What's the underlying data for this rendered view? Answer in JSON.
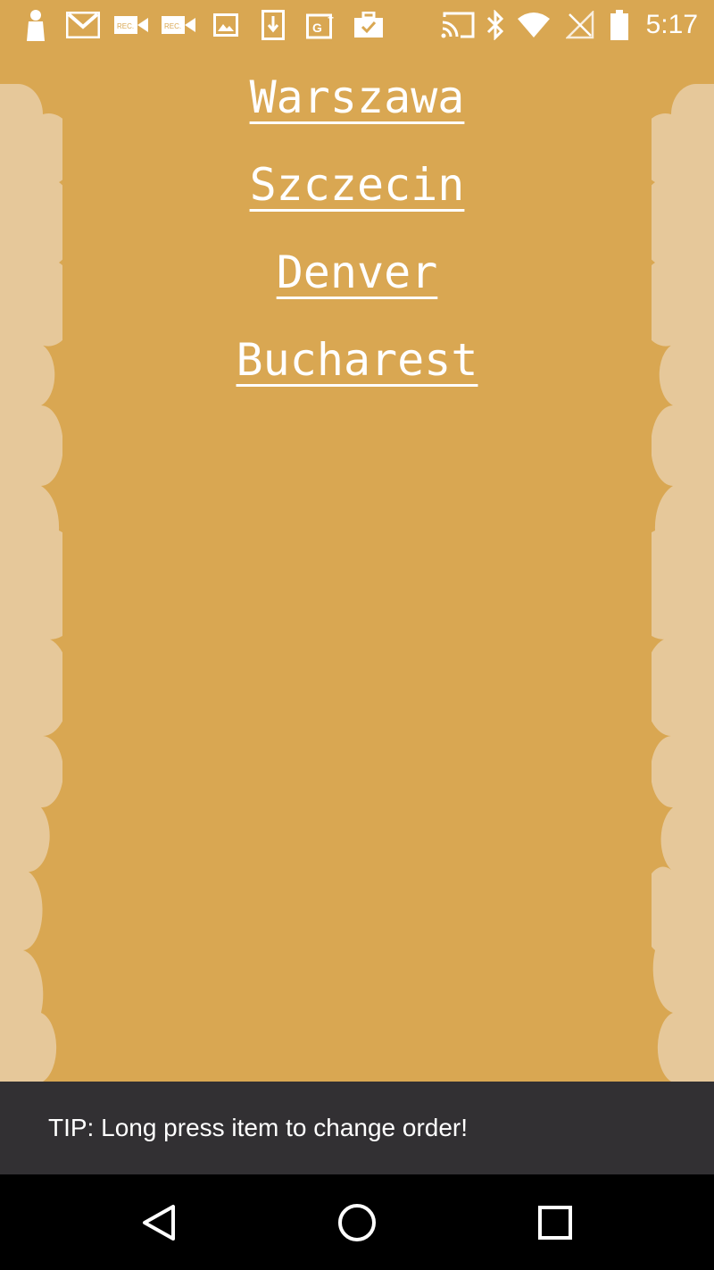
{
  "status_bar": {
    "time": "5:17",
    "left_icons": [
      "person-icon",
      "gmail-icon",
      "screen-record-icon",
      "screen-record-icon",
      "gallery-icon",
      "download-icon",
      "google-plus-icon",
      "work-briefcase-icon"
    ],
    "right_icons": [
      "cast-icon",
      "bluetooth-icon",
      "wifi-icon",
      "no-signal-icon",
      "battery-icon"
    ],
    "text_color": "#ffffff"
  },
  "cities": [
    "Warszawa",
    "Szczecin",
    "Denver",
    "Bucharest"
  ],
  "snackbar": {
    "message": "TIP: Long press item to change order!"
  },
  "nav_bar": {
    "buttons": [
      "back-icon",
      "home-icon",
      "recents-icon"
    ]
  },
  "colors": {
    "background": "#d9a752",
    "scallop": "#e6c89a",
    "snackbar": "#323033",
    "nav_bar": "#000000"
  }
}
